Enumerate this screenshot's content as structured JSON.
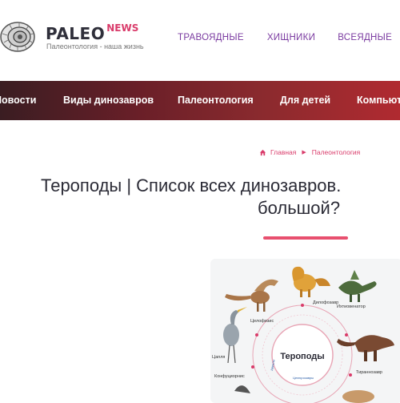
{
  "header": {
    "brand": "PALEO",
    "brand_suffix": "NEWS",
    "tagline": "Палеонтология - наша жизнь",
    "top_nav": [
      "ТРАВОЯДНЫЕ",
      "ХИЩНИКИ",
      "ВСЕЯДНЫЕ"
    ]
  },
  "main_nav": [
    "Новости",
    "Виды динозавров",
    "Палеонтология",
    "Для детей",
    "Компьютерные игры"
  ],
  "breadcrumb": {
    "home": "Главная",
    "current": "Палеонтология"
  },
  "article": {
    "title_line1": "Тероподы | Список всех динозавров.",
    "title_line2": "большой?"
  },
  "figure": {
    "center_label": "Тероподы",
    "labels": {
      "dilophosaurus": "Дилофозавр",
      "ichthyovenator": "Ихтиовенатор",
      "coelophysis": "Целофизис",
      "heron": "Цапля",
      "confuciusornis": "Конфуциорнис",
      "tyrannosaurus": "Тираннозавр",
      "ring_left": "Авиалы",
      "ring_bottom": "Целюрозавры"
    },
    "colors": {
      "accent": "#d93b6a",
      "ring": "#e8a5b5"
    }
  },
  "colors": {
    "nav_gradient_start": "#3a1d22",
    "nav_gradient_end": "#b02a30",
    "accent": "#d93b6a",
    "topnav_link": "#7a3aa0"
  }
}
